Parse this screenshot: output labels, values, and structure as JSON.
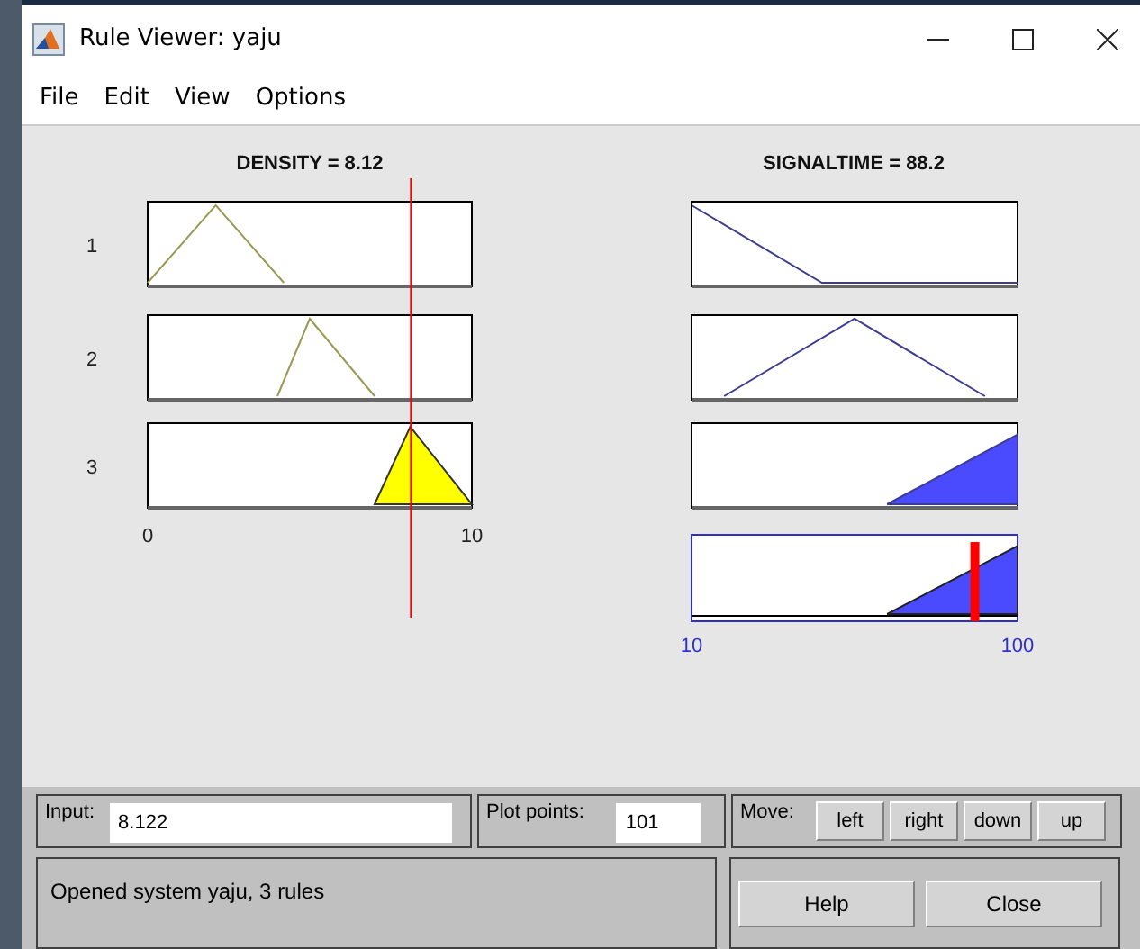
{
  "window": {
    "title": "Rule Viewer: yaju"
  },
  "menu": [
    "File",
    "Edit",
    "View",
    "Options"
  ],
  "input_variable": {
    "title": "DENSITY = 8.12",
    "ticks": [
      "0",
      "10"
    ],
    "rules": [
      {
        "number": "1",
        "kind": "low",
        "fired": false
      },
      {
        "number": "2",
        "kind": "mid",
        "fired": false
      },
      {
        "number": "3",
        "kind": "high",
        "fired": true
      }
    ]
  },
  "output_variable": {
    "title": "SIGNALTIME = 88.2",
    "ticks": [
      "10",
      "100"
    ],
    "rules": [
      {
        "kind": "low",
        "fired": false
      },
      {
        "kind": "mid",
        "fired": false
      },
      {
        "kind": "high",
        "fired": true
      }
    ]
  },
  "input_field": {
    "label": "Input:",
    "value": "8.122"
  },
  "plot_points": {
    "label": "Plot points:",
    "value": "101"
  },
  "move": {
    "label": "Move:",
    "buttons": [
      "left",
      "right",
      "down",
      "up"
    ]
  },
  "status": "Opened system yaju, 3 rules",
  "buttons": [
    "Help",
    "Close"
  ]
}
